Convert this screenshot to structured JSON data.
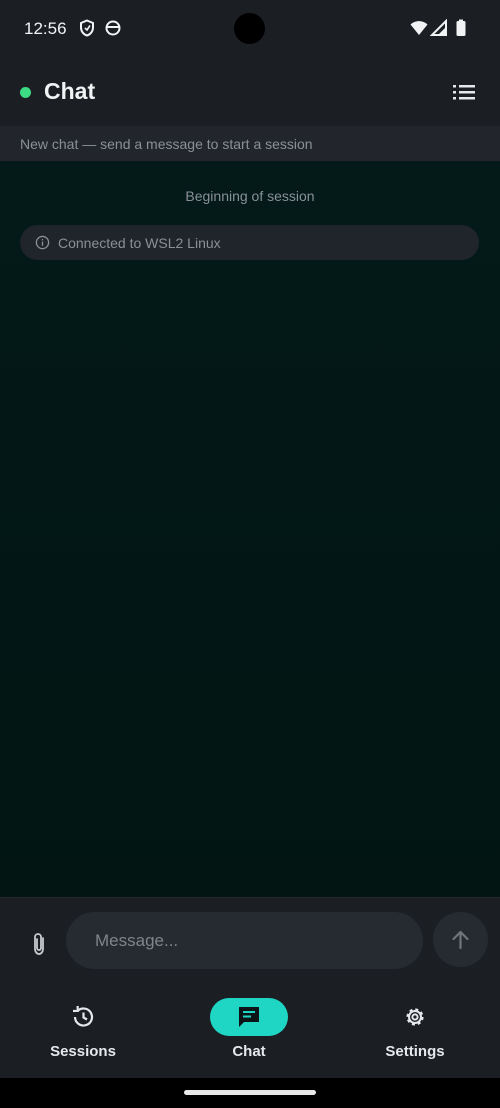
{
  "status_bar": {
    "time": "12:56",
    "icons": [
      "shield-icon",
      "face-icon",
      "wifi-icon",
      "signal-icon",
      "battery-icon"
    ]
  },
  "app_bar": {
    "title": "Chat",
    "status_color": "#3ddc84",
    "menu_icon": "list-icon"
  },
  "session_strip": {
    "text": "New chat — send a message to start a session"
  },
  "chat": {
    "session_marker": "Beginning of session",
    "system_message": "Connected to WSL2 Linux",
    "system_message_icon": "info-icon"
  },
  "composer": {
    "placeholder": "Message...",
    "value": "",
    "attach_icon": "paperclip-icon",
    "send_icon": "arrow-up-icon"
  },
  "bottom_nav": {
    "items": [
      {
        "label": "Sessions",
        "icon": "history-icon",
        "active": false
      },
      {
        "label": "Chat",
        "icon": "chat-icon",
        "active": true
      },
      {
        "label": "Settings",
        "icon": "gear-icon",
        "active": false
      }
    ],
    "active_color": "#1fd6c4"
  }
}
